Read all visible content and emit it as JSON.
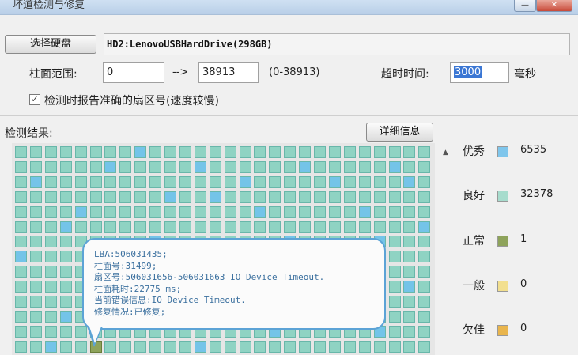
{
  "window": {
    "title": "坏道检测与修复",
    "minimize_glyph": "—",
    "close_glyph": "✕"
  },
  "toolbar": {
    "select_disk_label": "选择硬盘",
    "disk_name": "HD2:LenovoUSBHardDrive(298GB)"
  },
  "range": {
    "label": "柱面范围:",
    "from": "0",
    "arrow": "-->",
    "to": "38913",
    "hint": "(0-38913)"
  },
  "timeout": {
    "label": "超时时间:",
    "value": "3000",
    "unit": "毫秒"
  },
  "option": {
    "checked": true,
    "check_glyph": "✓",
    "label": "检测时报告准确的扇区号(速度较慢)"
  },
  "results": {
    "label": "检测结果:",
    "detail_button": "详细信息"
  },
  "legend": [
    {
      "name": "优秀",
      "value": "6535",
      "color": "#7fc6ec"
    },
    {
      "name": "良好",
      "value": "32378",
      "color": "#a7dccd"
    },
    {
      "name": "正常",
      "value": "1",
      "color": "#8ea35b"
    },
    {
      "name": "一般",
      "value": "0",
      "color": "#f2df8e"
    },
    {
      "name": "欠佳",
      "value": "0",
      "color": "#e9b54d"
    }
  ],
  "colors": {
    "good": "#8fd3c3",
    "excellent": "#74c4e8",
    "normal": "#8ea35b"
  },
  "tooltip": {
    "lines": [
      "LBA:506031435;",
      "柱面号:31499;",
      "扇区号:506031656-506031663  IO Device Timeout.",
      "柱面耗时:22775 ms;",
      "当前错误信息:IO Device Timeout.",
      "修复情况:已修复;"
    ]
  }
}
